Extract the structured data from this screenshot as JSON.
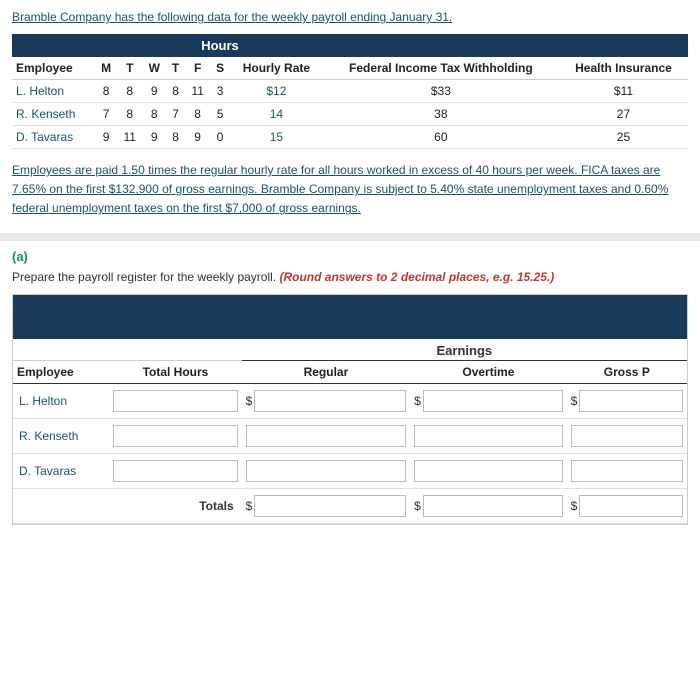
{
  "intro": {
    "text": "Bramble Company has the following data for the weekly payroll ending January 31."
  },
  "data_table": {
    "hours_header": "Hours",
    "col_headers": [
      "Employee",
      "M",
      "T",
      "W",
      "T",
      "F",
      "S",
      "Hourly Rate",
      "Federal Income Tax Withholding",
      "Health Insurance"
    ],
    "rows": [
      {
        "name": "L. Helton",
        "M": "8",
        "T": "8",
        "W": "9",
        "Th": "8",
        "F": "11",
        "S": "3",
        "rate": "$12",
        "fitw": "$33",
        "health": "$11"
      },
      {
        "name": "R. Kenseth",
        "M": "7",
        "T": "8",
        "W": "8",
        "Th": "7",
        "F": "8",
        "S": "5",
        "rate": "14",
        "fitw": "38",
        "health": "27"
      },
      {
        "name": "D. Tavaras",
        "M": "9",
        "T": "11",
        "W": "9",
        "Th": "8",
        "F": "9",
        "S": "0",
        "rate": "15",
        "fitw": "60",
        "health": "25"
      }
    ]
  },
  "note": "Employees are paid 1.50 times the regular hourly rate for all hours worked in excess of 40 hours per week. FICA taxes are 7.65% on the first $132,900 of gross earnings. Bramble Company is subject to 5.40% state unemployment taxes and 0.60% federal unemployment taxes on the first $7,000 of gross earnings.",
  "part_a": {
    "label": "(a)",
    "instruction_plain": "Prepare the payroll register for the weekly payroll.",
    "instruction_red": "(Round answers to 2 decimal places, e.g. 15.25.)"
  },
  "payroll_register": {
    "earnings_label": "Earnings",
    "col_headers": {
      "employee": "Employee",
      "total_hours": "Total Hours",
      "regular": "Regular",
      "overtime": "Overtime",
      "gross": "Gross P"
    },
    "rows": [
      {
        "name": "L. Helton",
        "has_dollar": true
      },
      {
        "name": "R. Kenseth",
        "has_dollar": false
      },
      {
        "name": "D. Tavaras",
        "has_dollar": false
      }
    ],
    "totals_label": "Totals"
  }
}
